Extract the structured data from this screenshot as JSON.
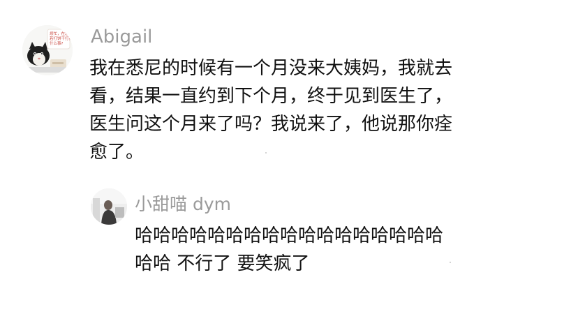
{
  "comment": {
    "author": "Abigail",
    "avatar_image_text": [
      "烦忙，在急,",
      "若打饼干打扎",
      "什么事?"
    ],
    "text_lines": [
      "我在悉尼的时候有一个月没来大姨妈，我就去",
      "看，结果一直约到下个月，终于见到医生了，",
      "医生问这个月来了吗？我说来了，他说那你痊",
      "愈了。"
    ]
  },
  "reply": {
    "author": "小甜喵 dym",
    "text_lines": [
      "哈哈哈哈哈哈哈哈哈哈哈哈哈哈哈哈哈",
      "哈哈 不行了 要笑疯了"
    ]
  },
  "colors": {
    "username": "#9a9a9a",
    "body_text": "#111111",
    "background": "#ffffff",
    "avatar_badge_red": "#c9473f"
  }
}
